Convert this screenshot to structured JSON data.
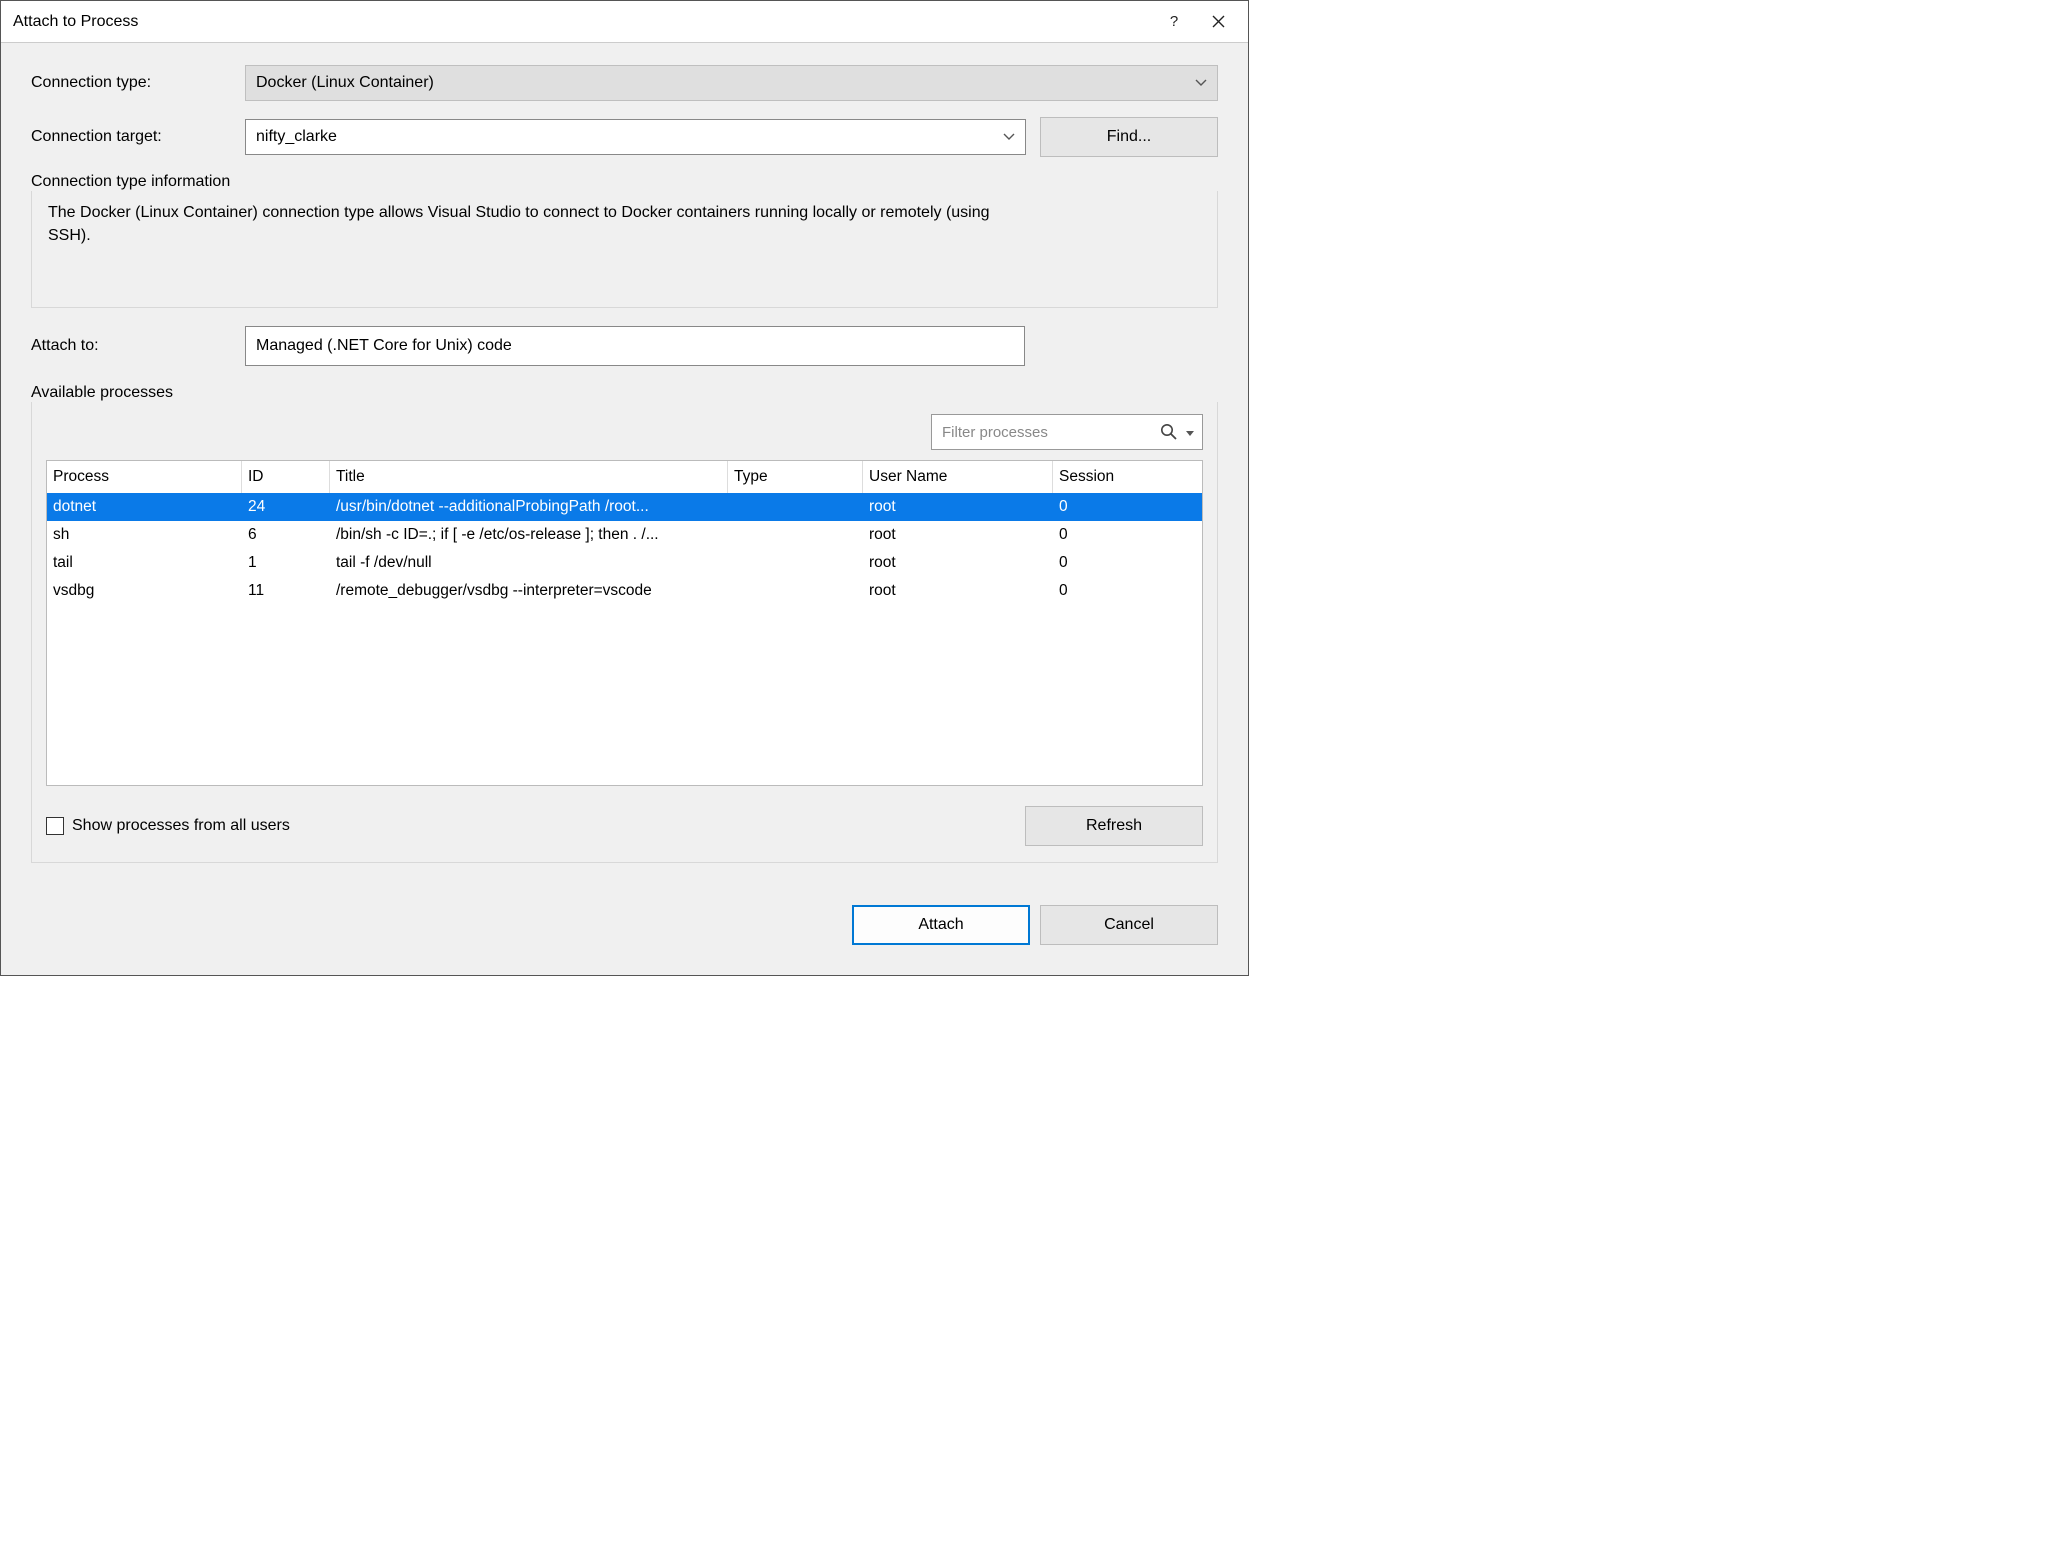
{
  "window": {
    "title": "Attach to Process"
  },
  "labels": {
    "connection_type": "Connection type:",
    "connection_target": "Connection target:",
    "connection_info_header": "Connection type information",
    "attach_to": "Attach to:",
    "available_processes": "Available processes",
    "show_all_users": "Show processes from all users"
  },
  "values": {
    "connection_type": "Docker (Linux Container)",
    "connection_target": "nifty_clarke",
    "attach_to": "Managed (.NET Core for Unix) code",
    "connection_info_text": "The Docker (Linux Container) connection type allows Visual Studio to connect to Docker containers running locally or remotely (using\nSSH)."
  },
  "buttons": {
    "find": "Find...",
    "refresh": "Refresh",
    "attach": "Attach",
    "cancel": "Cancel"
  },
  "filter": {
    "placeholder": "Filter processes"
  },
  "table": {
    "headers": {
      "process": "Process",
      "id": "ID",
      "title": "Title",
      "type": "Type",
      "user": "User Name",
      "session": "Session"
    },
    "rows": [
      {
        "process": "dotnet",
        "id": "24",
        "title": "/usr/bin/dotnet --additionalProbingPath /root...",
        "type": "",
        "user": "root",
        "session": "0",
        "selected": true
      },
      {
        "process": "sh",
        "id": "6",
        "title": "/bin/sh -c ID=.; if [ -e /etc/os-release ]; then . /...",
        "type": "",
        "user": "root",
        "session": "0",
        "selected": false
      },
      {
        "process": "tail",
        "id": "1",
        "title": "tail -f /dev/null",
        "type": "",
        "user": "root",
        "session": "0",
        "selected": false
      },
      {
        "process": "vsdbg",
        "id": "11",
        "title": "/remote_debugger/vsdbg --interpreter=vscode",
        "type": "",
        "user": "root",
        "session": "0",
        "selected": false
      }
    ]
  }
}
